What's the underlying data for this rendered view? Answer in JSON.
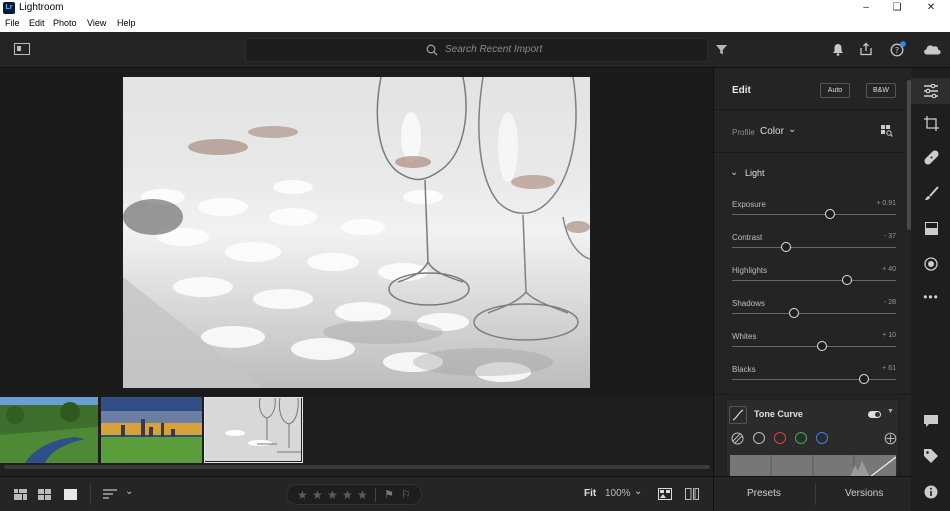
{
  "window": {
    "title": "Lightroom",
    "logo": "Lr"
  },
  "menu": [
    "File",
    "Edit",
    "Photo",
    "View",
    "Help"
  ],
  "search": {
    "placeholder": "Search Recent Import"
  },
  "edit_panel": {
    "title": "Edit",
    "auto_label": "Auto",
    "bw_label": "B&W",
    "profile_label": "Profile",
    "profile_value": "Color",
    "light_section": "Light",
    "sliders": [
      {
        "label": "Exposure",
        "value": "+ 0.91",
        "position": 0.595
      },
      {
        "label": "Contrast",
        "value": "- 37",
        "position": 0.33
      },
      {
        "label": "Highlights",
        "value": "+ 40",
        "position": 0.7
      },
      {
        "label": "Shadows",
        "value": "- 28",
        "position": 0.375
      },
      {
        "label": "Whites",
        "value": "+ 10",
        "position": 0.55
      },
      {
        "label": "Blacks",
        "value": "+ 61",
        "position": 0.805
      }
    ],
    "tone_curve_label": "Tone Curve",
    "channel_colors": [
      "#bdbdbd",
      "#e23b3b",
      "#34b24a",
      "#3c7ff0"
    ]
  },
  "bottom": {
    "fit_label": "Fit",
    "zoom": "100%",
    "presets_label": "Presets",
    "versions_label": "Versions"
  },
  "rating": {
    "stars": 0,
    "max": 5
  },
  "filmstrip": [
    {
      "name": "river-landscape"
    },
    {
      "name": "city-skyline-sunset"
    },
    {
      "name": "wine-glasses",
      "selected": true
    }
  ],
  "colors": {
    "accent": "#2d8ceb"
  }
}
